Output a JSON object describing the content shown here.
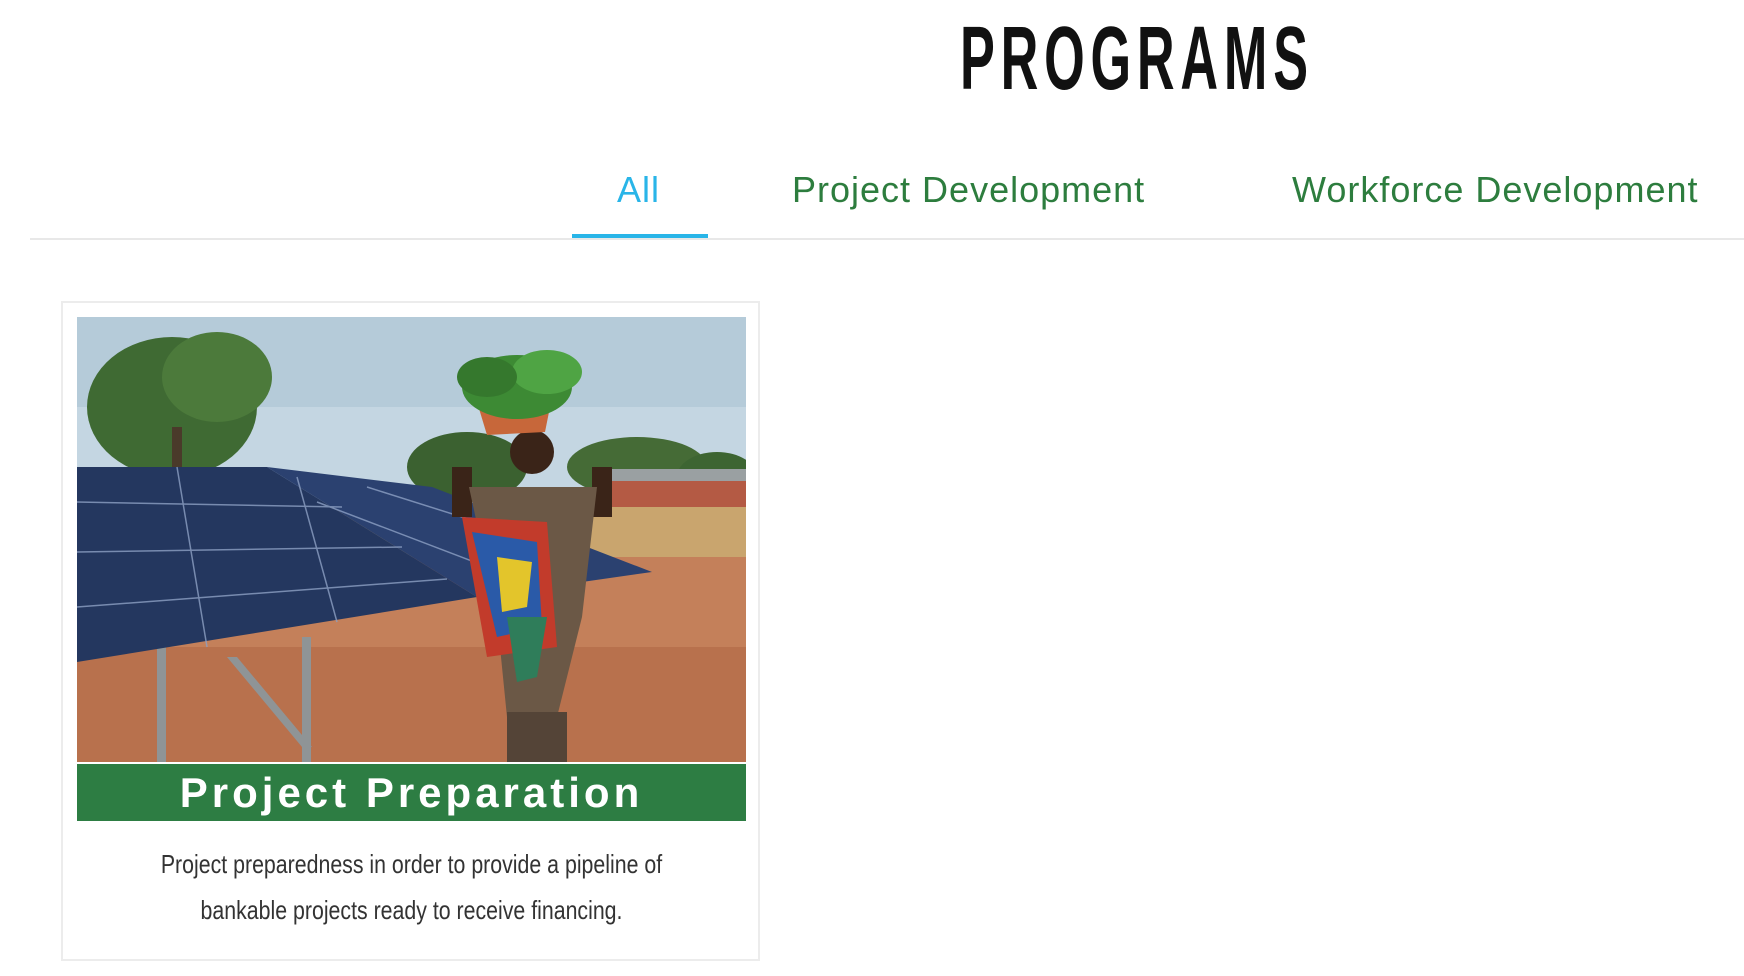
{
  "page": {
    "title": "PROGRAMS"
  },
  "tabs": [
    {
      "label": "All",
      "active": true
    },
    {
      "label": "Project Development",
      "active": false
    },
    {
      "label": "Workforce Development",
      "active": false
    }
  ],
  "cards": [
    {
      "title": "Project Preparation",
      "description": "Project preparedness in order to provide a pipeline of bankable projects ready to receive financing.",
      "image": "photo-solar-panels-woman-carrying-basket"
    }
  ],
  "colors": {
    "accent": "#29b5e8",
    "brand_green": "#2d7d43",
    "title": "#111111",
    "text": "#333333"
  }
}
